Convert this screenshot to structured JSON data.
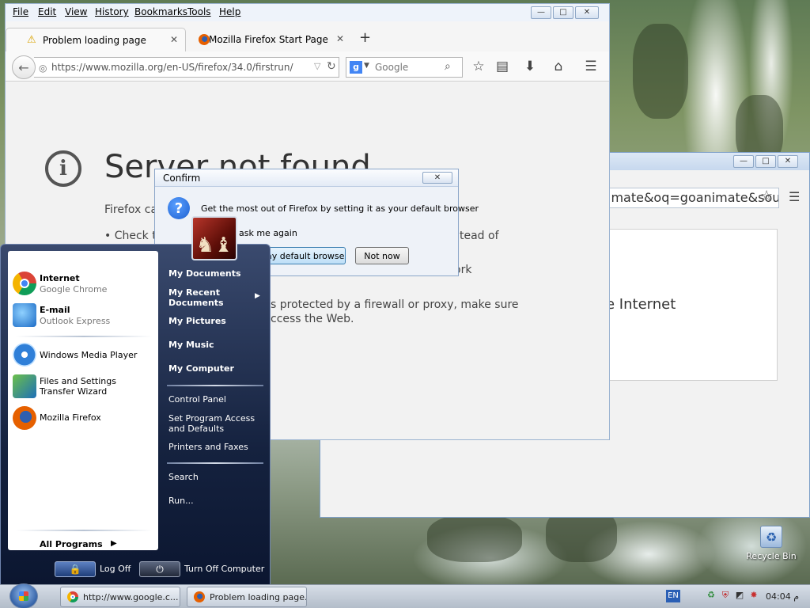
{
  "firefox": {
    "menu": [
      "File",
      "Edit",
      "View",
      "History",
      "Bookmarks",
      "Tools",
      "Help"
    ],
    "tabs": [
      {
        "label": "Problem loading page",
        "icon": "warning-icon"
      },
      {
        "label": "Mozilla Firefox Start Page",
        "icon": "firefox-icon"
      }
    ],
    "url": "https://www.mozilla.org/en-US/firefox/34.0/firstrun/",
    "search_placeholder": "Google",
    "error": {
      "title": "Server not found",
      "line1": "Firefox ca",
      "bullet1": "• Check t",
      "bullet1_tail": "tead of",
      "bullet2_tail": "ork",
      "line_proxy": "s protected by a firewall or proxy, make sure",
      "line_web": "ccess the Web."
    }
  },
  "chrome": {
    "omnibox_text": "imate&oq=goanimate&sou",
    "card_text": "e Internet"
  },
  "confirm": {
    "title": "Confirm",
    "message": "Get the most out of Firefox by setting it as your default browser",
    "ask_again": "ask me again",
    "default_button": "my default browser",
    "not_now_button": "Not now",
    "close_glyph": "✕"
  },
  "start_menu": {
    "pinned": [
      {
        "name": "Internet",
        "sub": "Google Chrome"
      },
      {
        "name": "E-mail",
        "sub": "Outlook Express"
      }
    ],
    "recent": [
      {
        "name": "Windows Media Player"
      },
      {
        "name": "Files and Settings Transfer Wizard"
      },
      {
        "name": "Mozilla Firefox"
      }
    ],
    "all_programs": "All Programs",
    "right_bold": [
      "My Documents",
      "My Recent Documents",
      "My Pictures",
      "My Music",
      "My Computer"
    ],
    "right_plain": [
      "Control Panel",
      "Set Program Access and Defaults",
      "Printers and Faxes"
    ],
    "right_bottom": [
      "Search",
      "Run..."
    ],
    "log_off": "Log Off",
    "turn_off": "Turn Off Computer"
  },
  "taskbar": {
    "tasks": [
      {
        "label": "http://www.google.c...",
        "icon": "chrome-icon"
      },
      {
        "label": "Problem loading page...",
        "icon": "firefox-icon"
      }
    ],
    "language": "EN",
    "clock": "04:04 م"
  },
  "desktop": {
    "recycle_bin": "Recycle Bin"
  }
}
